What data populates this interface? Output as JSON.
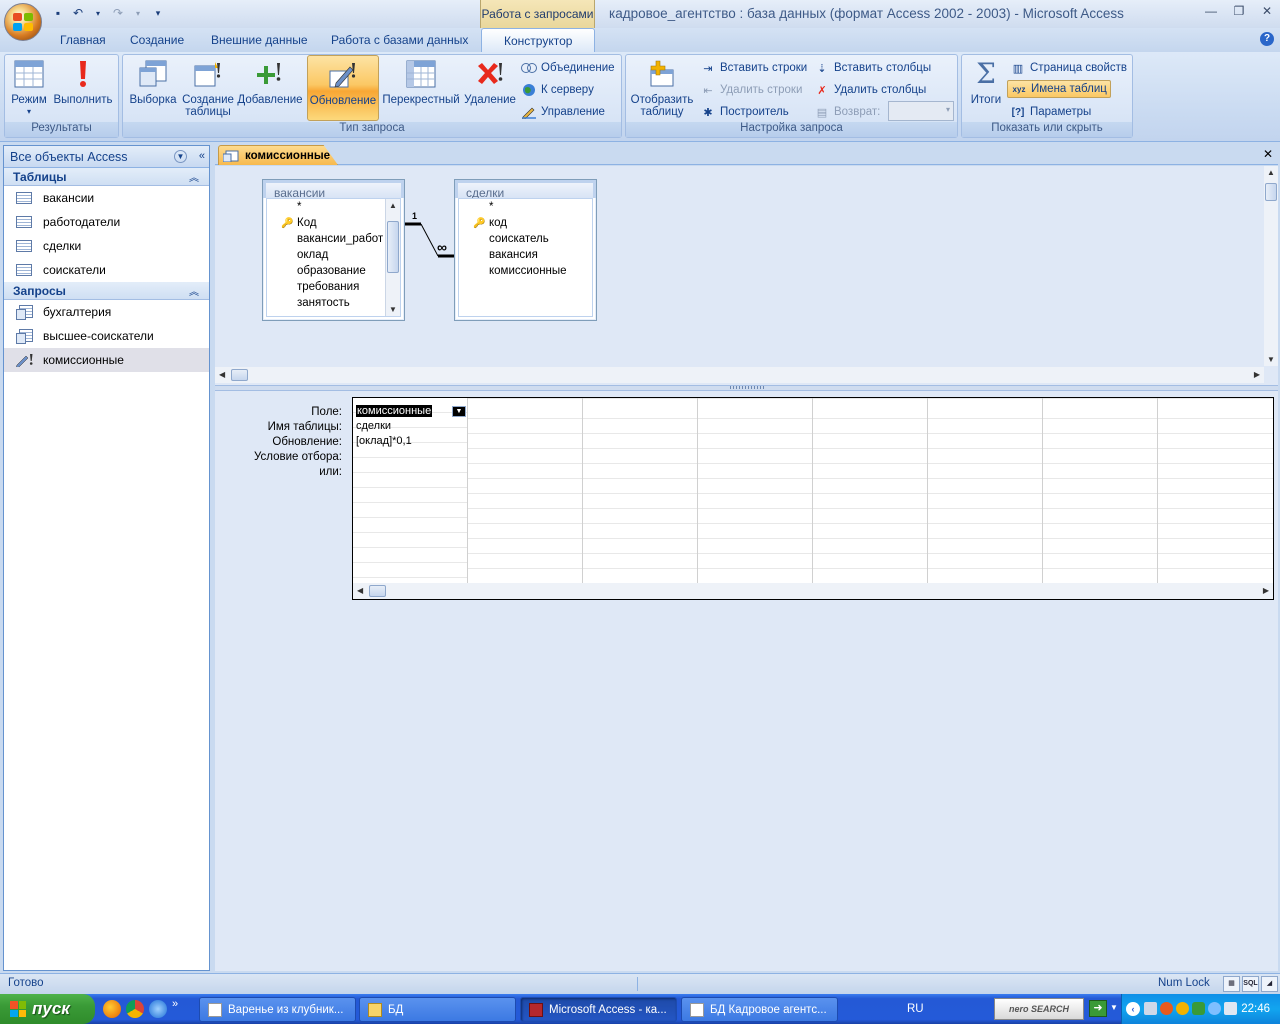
{
  "window": {
    "context_tab": "Работа с запросами",
    "title": "кадровое_агентство : база данных (формат Access 2002 - 2003) - Microsoft Access"
  },
  "ribbon_tabs": [
    "Главная",
    "Создание",
    "Внешние данные",
    "Работа с базами данных",
    "Конструктор"
  ],
  "ribbon": {
    "results": {
      "label": "Результаты",
      "view": "Режим",
      "run": "Выполнить"
    },
    "query_type": {
      "label": "Тип запроса",
      "select": "Выборка",
      "make_table_line1": "Создание",
      "make_table_line2": "таблицы",
      "append": "Добавление",
      "update": "Обновление",
      "crosstab": "Перекрестный",
      "delete": "Удаление",
      "union": "Объединение",
      "pass_through": "К серверу",
      "data_definition": "Управление"
    },
    "query_setup": {
      "label": "Настройка запроса",
      "show_table_line1": "Отобразить",
      "show_table_line2": "таблицу",
      "insert_rows": "Вставить строки",
      "delete_rows": "Удалить строки",
      "builder": "Построитель",
      "insert_columns": "Вставить столбцы",
      "delete_columns": "Удалить столбцы",
      "return": "Возврат:"
    },
    "show_hide": {
      "label": "Показать или скрыть",
      "totals": "Итоги",
      "property_sheet": "Страница свойств",
      "table_names": "Имена таблиц",
      "parameters": "Параметры"
    }
  },
  "nav": {
    "header": "Все объекты Access",
    "tables_label": "Таблицы",
    "tables": [
      "вакансии",
      "работодатели",
      "сделки",
      "соискатели"
    ],
    "queries_label": "Запросы",
    "queries": [
      "бухгалтерия",
      "высшее-соискатели",
      "комиссионные"
    ]
  },
  "document": {
    "tab": "комиссионные"
  },
  "field_lists": [
    {
      "title": "вакансии",
      "fields": [
        "*",
        "Код",
        "вакансии_работ",
        "оклад",
        "образование",
        "требования",
        "занятость"
      ],
      "key_index": 1
    },
    {
      "title": "сделки",
      "fields": [
        "*",
        "код",
        "соискатель",
        "вакансия",
        "комиссионные"
      ],
      "key_index": 1
    }
  ],
  "relationship": {
    "one": "1",
    "many": "∞"
  },
  "design_grid": {
    "row_labels": [
      "Поле:",
      "Имя таблицы:",
      "Обновление:",
      "Условие отбора:",
      "или:"
    ],
    "columns": [
      {
        "field": "комиссионные",
        "table": "сделки",
        "update": "[оклад]*0,1",
        "criteria": "",
        "or": ""
      }
    ]
  },
  "statusbar": {
    "status": "Готово",
    "numlock": "Num Lock",
    "views": [
      "▦",
      "SQL",
      "◢"
    ]
  },
  "taskbar": {
    "start": "пуск",
    "buttons": [
      "Варенье из клубник...",
      "БД",
      "Microsoft Access - ка...",
      "БД Кадровое агентс..."
    ],
    "lang": "RU",
    "nero": "nero SEARCH",
    "time": "22:46"
  }
}
